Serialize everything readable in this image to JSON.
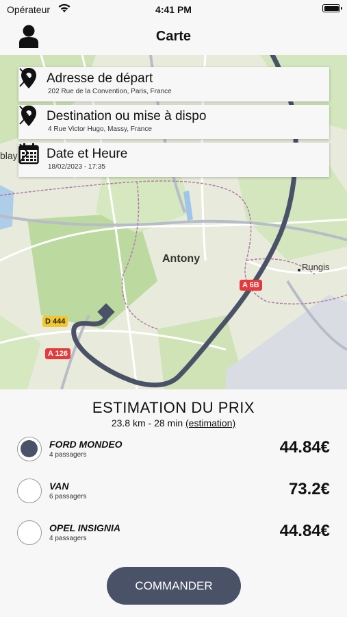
{
  "status_bar": {
    "carrier": "Opérateur",
    "time": "4:41 PM",
    "battery_level": 1.0
  },
  "nav": {
    "title": "Carte",
    "profile_icon": "person-icon"
  },
  "map": {
    "labels": {
      "city": "Antony",
      "town": "Rungis",
      "edge": "blay"
    },
    "road_signs": [
      "A 6B",
      "D 444",
      "A 126"
    ]
  },
  "trip": {
    "departure": {
      "title": "Adresse de départ",
      "value": "202 Rue de la Convention, Paris, France",
      "icon": "location-pin-icon"
    },
    "destination": {
      "title": "Destination ou mise à dispo",
      "value": "4 Rue Victor Hugo, Massy, France",
      "icon": "location-pin-icon"
    },
    "datetime": {
      "title": "Date et Heure",
      "value": "18/02/2023 - 17:35",
      "icon": "calendar-icon"
    }
  },
  "estimate": {
    "title": "ESTIMATION DU PRIX",
    "summary": "23.8 km - 28 min ",
    "link": "(estimation)"
  },
  "vehicles": [
    {
      "name": "FORD MONDEO",
      "capacity": "4 passagers",
      "price": "44.84€",
      "selected": true
    },
    {
      "name": "VAN",
      "capacity": "6 passagers",
      "price": "73.2€",
      "selected": false
    },
    {
      "name": "OPEL INSIGNIA",
      "capacity": "4 passagers",
      "price": "44.84€",
      "selected": false
    }
  ],
  "order_button": "COMMANDER",
  "colors": {
    "accent": "#4a5268",
    "route": "#4a5268"
  }
}
